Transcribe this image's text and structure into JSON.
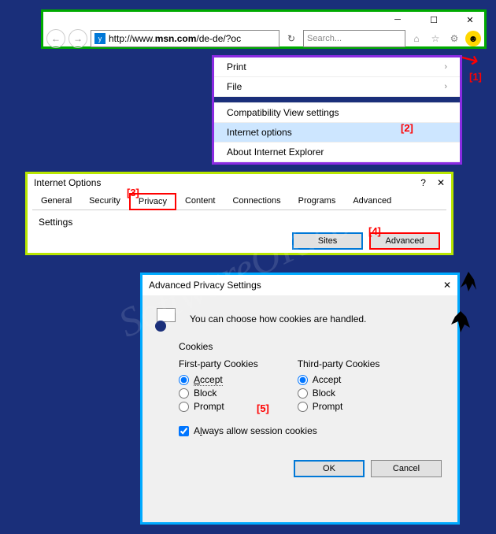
{
  "watermark": "SoftwareOK.com",
  "browser": {
    "url_prefix": "http://www.",
    "url_bold": "msn.com",
    "url_suffix": "/de-de/?oc",
    "search_placeholder": "Search..."
  },
  "menu": {
    "items": [
      "Print",
      "File",
      "Compatibility View settings",
      "Internet options",
      "About Internet Explorer"
    ],
    "highlighted": "Internet options"
  },
  "callouts": {
    "c1": "[1]",
    "c2": "[2]",
    "c3": "[3]",
    "c4": "[4]",
    "c5": "[5]"
  },
  "iopts": {
    "title": "Internet Options",
    "tabs": [
      "General",
      "Security",
      "Privacy",
      "Content",
      "Connections",
      "Programs",
      "Advanced"
    ],
    "active_tab": "Privacy",
    "settings_label": "Settings",
    "btn_sites": "Sites",
    "btn_advanced": "Advanced"
  },
  "adv": {
    "title": "Advanced Privacy Settings",
    "desc": "You can choose how cookies are handled.",
    "cookies_label": "Cookies",
    "first_label": "First-party Cookies",
    "third_label": "Third-party Cookies",
    "opt_accept": "Accept",
    "opt_block": "Block",
    "opt_prompt": "Prompt",
    "always_label": "Always allow session cookies",
    "btn_ok": "OK",
    "btn_cancel": "Cancel"
  },
  "u_accept": "A",
  "u_always": "l"
}
